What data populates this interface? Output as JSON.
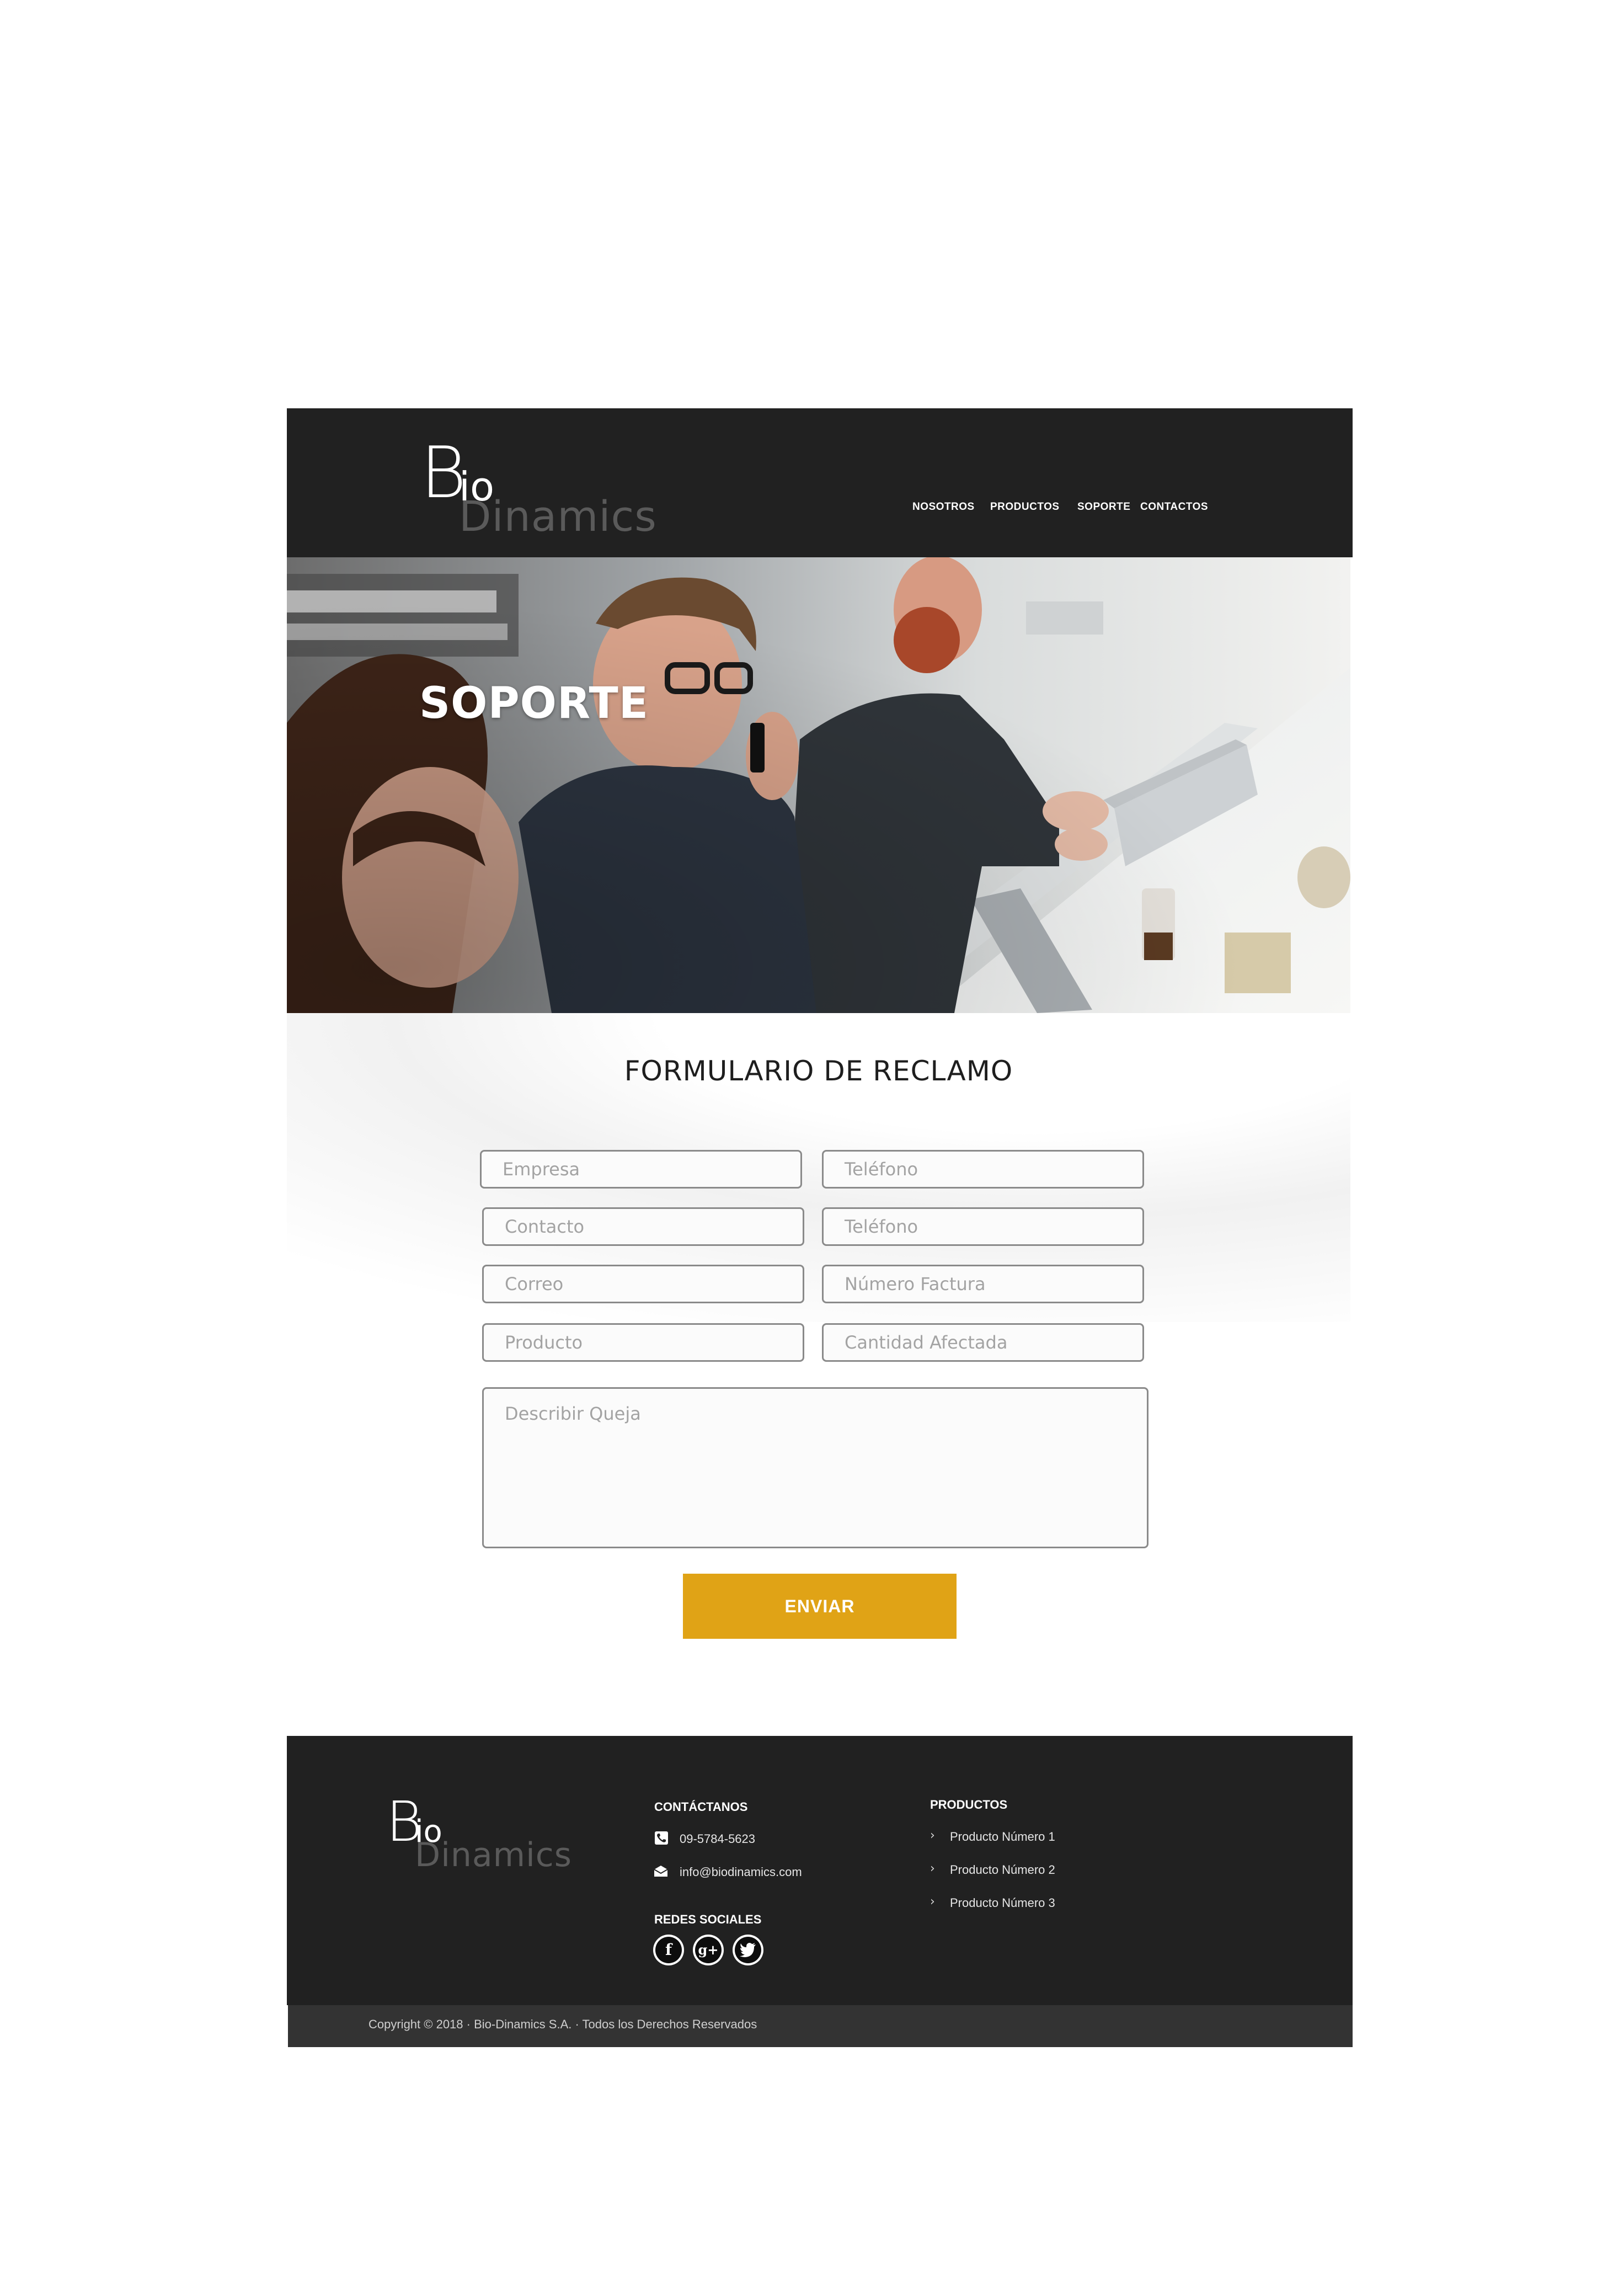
{
  "brand": {
    "logo_b": "B",
    "logo_io": "io",
    "logo_dinamics": "Dinamics"
  },
  "nav": {
    "items": [
      "NOSOTROS",
      "PRODUCTOS",
      "SOPORTE",
      "CONTACTOS"
    ]
  },
  "hero": {
    "title": "SOPORTE"
  },
  "form": {
    "title": "FORMULARIO DE RECLAMO",
    "fields": {
      "empresa": "Empresa",
      "telefono_1": "Teléfono",
      "contacto": "Contacto",
      "telefono_2": "Teléfono",
      "correo": "Correo",
      "numero_factura": "Número Factura",
      "producto": "Producto",
      "cantidad_afectada": "Cantidad Afectada",
      "describir_queja": "Describir Queja"
    },
    "submit_label": "ENVIAR"
  },
  "footer": {
    "contact_heading": "CONTÁCTANOS",
    "phone": "09-5784-5623",
    "email": "info@biodinamics.com",
    "social_heading": "REDES SOCIALES",
    "social": {
      "facebook": "f",
      "googleplus": "g+",
      "twitter": "twitter"
    },
    "products_heading": "PRODUCTOS",
    "products": [
      "Producto Número 1",
      "Producto Número 2",
      "Producto Número 3"
    ],
    "copyright": "Copyright © 2018 · Bio-Dinamics S.A. · Todos los Derechos Reservados"
  },
  "colors": {
    "header_bg": "#212121",
    "accent": "#e0a316",
    "copyright_bg": "#333333"
  }
}
